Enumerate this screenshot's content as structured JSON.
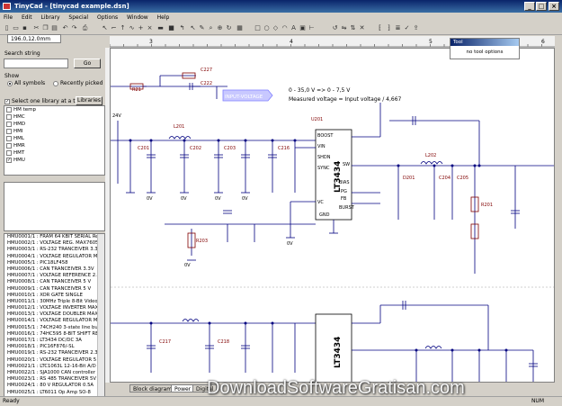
{
  "window": {
    "title": "TinyCad - [tinycad example.dsn]"
  },
  "menu": [
    "File",
    "Edit",
    "Library",
    "Special",
    "Options",
    "Window",
    "Help"
  ],
  "toolbar": {
    "coordinates": "196.0,12.0mm"
  },
  "left": {
    "search_label": "Search string",
    "search_value": "",
    "go_label": "Go",
    "show_label": "Show",
    "opt_all": "All symbols",
    "opt_recent": "Recently picked",
    "select_one_label": "Select one library at a time",
    "libraries_button": "Libraries",
    "libraries": [
      "HM temp",
      "HMC",
      "HMD",
      "HMI",
      "HML",
      "HMR",
      "HMT",
      "HMU"
    ],
    "parts": [
      "HMU0001/1 : FRAM 64 KBIT SERIAL Re",
      "HMU0002/1 : VOLTAGE REG. MAX7605",
      "HMU0003/1 : RS-232 TRANCEIVER 3.3",
      "HMU0004/1 : VOLTAGE REGULATOR MA",
      "HMU0005/1 : PIC18LF458",
      "HMU0006/1 : CAN TRANCEIVER 3.3V",
      "HMU0007/1 : VOLTAGE REFERENCE 2.5",
      "HMU0008/1 : CAN TRANCEIVER 5 V",
      "HMU0009/1 : CAN TRANCEIVER 5 V",
      "HMU0010/1 : XOR GATE SINGLE",
      "HMU0011/1 : 30MHz Triple 8-Bit Video D",
      "HMU0012/1 : VOLTAGE INVERTER MAX",
      "HMU0013/1 : VOLTAGE DOUBLER MAX",
      "HMU0014/1 : VOLTAGE REGULATOR M",
      "HMU0015/1 : 74CH240 3-state line buffer",
      "HMU0016/1 : 74HC595 8-BIT SHIFT REG",
      "HMU0017/1 : LT3434 DC/DC 3A",
      "HMU0018/1 : PIC16F876/-SL",
      "HMU0019/1 : RS-232 TRANCEIVER 2.3",
      "HMU0020/1 : VOLTAGE REGULATOR 5",
      "HMU0021/1 : LTC1063L 12-16-Bit A/D",
      "HMU0022/1 : SJA1000 CAN controller",
      "HMU0023/1 : RS 485 TRANCEIVER 5V",
      "HMU0024/1 : 80 V REGULATOR 0.5A",
      "HMU0025/1 : LT6011 Op Amp SO-8",
      "HMU0026/1 : EXAR 16C550"
    ]
  },
  "canvas": {
    "ruler_marks": [
      "3",
      "4",
      "5",
      "6"
    ],
    "formula1": "0 - 35,0 V => 0 - 7,5 V",
    "formula2": "Measured voltage = Input voltage / 4,667",
    "input_voltage": "INPUT-VOLTAGE",
    "chip1": "LT3434",
    "chip2": "LT3434",
    "pin_boost": "BOOST",
    "pin_vin": "VIN",
    "pin_shdn": "SHDN",
    "pin_sync": "SYNC",
    "pin_vc": "VC",
    "pin_gnd": "GND",
    "pin_fb": "FB",
    "pin_sw": "SW",
    "pin_bias": "BIAS",
    "pin_pg": "PG",
    "pin_burst": "BURST",
    "label_24v": "24V",
    "label_0v": "0V",
    "label_r21": "R21",
    "label_r22": "R22",
    "label_c222": "C222",
    "label_c227": "C227",
    "label_l201": "L201",
    "label_l202": "L202",
    "label_d201": "D201",
    "label_r201": "R201",
    "label_r203": "R203",
    "label_c201": "C201",
    "label_c202": "C202",
    "label_c203": "C203",
    "label_c204": "C204",
    "label_c205": "C205",
    "label_c216": "C216",
    "label_c217": "C217",
    "label_c218": "C218",
    "label_u201": "U201"
  },
  "tabs": [
    "Block diagram",
    "Power",
    "Digital"
  ],
  "status": {
    "left": "Ready",
    "right": "NUM"
  },
  "popup": {
    "title": "Tool",
    "item": "no tool options"
  },
  "watermark": "DownloadSoftwareGratisan.com",
  "colors": {
    "title": "#0a246a",
    "wire": "#000080",
    "label": "#800000",
    "highlight": "#8080ff"
  }
}
